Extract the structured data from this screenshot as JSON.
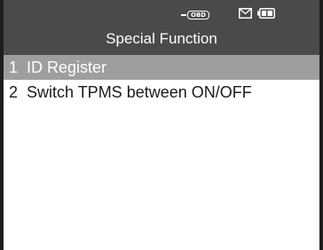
{
  "header": {
    "title": "Special Function",
    "status_icons": {
      "obd": {
        "icon": "obd-connector-icon",
        "text": "OBD"
      },
      "mail": {
        "icon": "mail-icon"
      },
      "battery": {
        "icon": "battery-icon"
      }
    }
  },
  "menu": {
    "items": [
      {
        "number": "1",
        "label": "ID Register",
        "selected": true
      },
      {
        "number": "2",
        "label": "Switch TPMS between ON/OFF",
        "selected": false
      }
    ]
  },
  "colors": {
    "header_bg": "#4a4a4a",
    "selected_bg": "#9e9e9e",
    "frame": "#1e1e1e",
    "text": "#1a1a1a"
  }
}
